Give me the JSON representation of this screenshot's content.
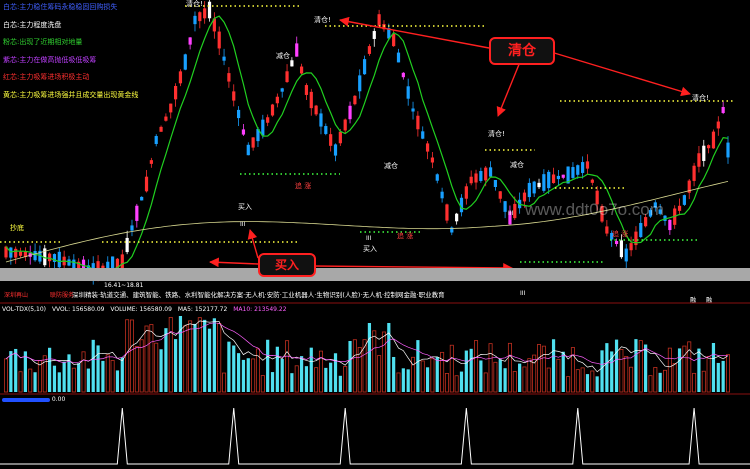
{
  "legend": [
    {
      "text": "白芯:主力稳住筹码永稳稳固回购损失",
      "color": "#4060ff"
    },
    {
      "text": "白芯:主力程度洗盘",
      "color": "#ffffff"
    },
    {
      "text": "粉芯:出现了近期相对地量",
      "color": "#30d030"
    },
    {
      "text": "紫芯:主力在做高抛低吸低吸筹",
      "color": "#c040ff"
    },
    {
      "text": "红芯:主力吸筹进场积极主动",
      "color": "#ff3030"
    },
    {
      "text": "黄芯:主力吸筹进场强并且成交量出现黄金线",
      "color": "#ffff40"
    }
  ],
  "callouts": {
    "sell": "清仓",
    "buy": "买入"
  },
  "markers": {
    "clear_label": "清仓!",
    "reduce_label": "减仓",
    "buy_label": "买入",
    "iii": "III",
    "chase": "追 涨",
    "bottom": "抄底",
    "box_value": "16.41~18.81"
  },
  "bottom_tags": [
    "深圳再山",
    "联防服务"
  ],
  "sector_text": "深圳精装·轨道交通、建筑智能、铁路、水利智能化解决方案·无人机·安防·工业机器人·生物识别(人脸)·无人机·控制网金融·职业教育",
  "sector_marks": [
    "融",
    "融"
  ],
  "volume_header": {
    "indicator": "VOL-TDX(5,10)",
    "vvol": "VVOL: 156580.09",
    "volume": "VOLUME: 156580.09",
    "ma5": "MA5: 152177.72",
    "ma10": "MA10: 213549.22"
  },
  "lower_header": "0.00",
  "watermark": "www.ddt0o7o.com",
  "colors": {
    "up": "#ff3030",
    "down": "#18a0ff",
    "ma_green": "#20d020",
    "ma_slow": "#d8d890",
    "vol_up": "#c03020",
    "vol_down": "#50e0f0"
  },
  "chart_data": [
    {
      "type": "candlestick",
      "name": "price",
      "grid": false
    },
    {
      "type": "bar",
      "name": "volume",
      "ma_lines": [
        "MA5",
        "MA10"
      ]
    },
    {
      "type": "line",
      "name": "lower-indicator",
      "value_min": 0.0,
      "spike_bars": [
        24,
        47,
        70,
        95,
        118,
        142
      ]
    }
  ]
}
